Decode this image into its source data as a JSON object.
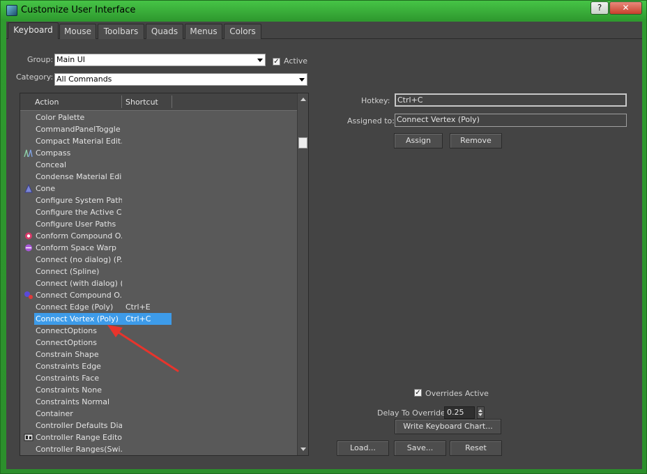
{
  "window": {
    "title": "Customize User Interface",
    "help_label": "?",
    "close_label": "✕"
  },
  "tabs": [
    {
      "label": "Keyboard",
      "active": true
    },
    {
      "label": "Mouse"
    },
    {
      "label": "Toolbars"
    },
    {
      "label": "Quads"
    },
    {
      "label": "Menus"
    },
    {
      "label": "Colors"
    }
  ],
  "group": {
    "label": "Group:",
    "value": "Main UI"
  },
  "active": {
    "label": "Active",
    "checked": true,
    "mark": "✓"
  },
  "category": {
    "label": "Category:",
    "value": "All Commands"
  },
  "list": {
    "headers": {
      "action": "Action",
      "shortcut": "Shortcut"
    },
    "rows": [
      {
        "action": "Color Palette",
        "shortcut": "",
        "icon": ""
      },
      {
        "action": "CommandPanelToggle",
        "shortcut": "",
        "icon": ""
      },
      {
        "action": "Compact Material Edit...",
        "shortcut": "",
        "icon": ""
      },
      {
        "action": "Compass",
        "shortcut": "",
        "icon": "compass-icon"
      },
      {
        "action": "Conceal",
        "shortcut": "",
        "icon": ""
      },
      {
        "action": "Condense Material Edi...",
        "shortcut": "",
        "icon": ""
      },
      {
        "action": "Cone",
        "shortcut": "",
        "icon": "cone-icon"
      },
      {
        "action": "Configure System Paths",
        "shortcut": "",
        "icon": ""
      },
      {
        "action": "Configure the Active C...",
        "shortcut": "",
        "icon": ""
      },
      {
        "action": "Configure User Paths",
        "shortcut": "",
        "icon": ""
      },
      {
        "action": "Conform Compound O...",
        "shortcut": "",
        "icon": "conform-compound-icon"
      },
      {
        "action": "Conform Space Warp",
        "shortcut": "",
        "icon": "conform-space-warp-icon"
      },
      {
        "action": "Connect (no dialog) (P...",
        "shortcut": "",
        "icon": ""
      },
      {
        "action": "Connect (Spline)",
        "shortcut": "",
        "icon": ""
      },
      {
        "action": "Connect (with dialog) (...",
        "shortcut": "",
        "icon": ""
      },
      {
        "action": "Connect Compound O...",
        "shortcut": "",
        "icon": "connect-compound-icon"
      },
      {
        "action": "Connect Edge (Poly)",
        "shortcut": "Ctrl+E",
        "icon": ""
      },
      {
        "action": "Connect Vertex (Poly)",
        "shortcut": "Ctrl+C",
        "icon": "",
        "selected": true
      },
      {
        "action": "ConnectOptions",
        "shortcut": "",
        "icon": ""
      },
      {
        "action": "ConnectOptions",
        "shortcut": "",
        "icon": ""
      },
      {
        "action": "Constrain Shape",
        "shortcut": "",
        "icon": ""
      },
      {
        "action": "Constraints Edge",
        "shortcut": "",
        "icon": ""
      },
      {
        "action": "Constraints Face",
        "shortcut": "",
        "icon": ""
      },
      {
        "action": "Constraints None",
        "shortcut": "",
        "icon": ""
      },
      {
        "action": "Constraints Normal",
        "shortcut": "",
        "icon": ""
      },
      {
        "action": "Container",
        "shortcut": "",
        "icon": ""
      },
      {
        "action": "Controller Defaults Dia...",
        "shortcut": "",
        "icon": ""
      },
      {
        "action": "Controller Range Edito...",
        "shortcut": "",
        "icon": "controller-range-icon"
      },
      {
        "action": "Controller Ranges(Swi...",
        "shortcut": "",
        "icon": ""
      }
    ]
  },
  "hotkey": {
    "label": "Hotkey:",
    "value": "Ctrl+C"
  },
  "assigned": {
    "label": "Assigned to:",
    "value": "Connect Vertex (Poly)"
  },
  "buttons": {
    "assign": "Assign",
    "remove": "Remove",
    "write_chart": "Write Keyboard Chart...",
    "load": "Load...",
    "save": "Save...",
    "reset": "Reset"
  },
  "overrides": {
    "label": "Overrides Active",
    "checked": true,
    "mark": "✓"
  },
  "delay": {
    "label": "Delay To Override:",
    "value": "0.25"
  },
  "colors": {
    "selection": "#3d9be9",
    "annotation_arrow": "#e8342c",
    "title_green": "#3fb83f"
  }
}
